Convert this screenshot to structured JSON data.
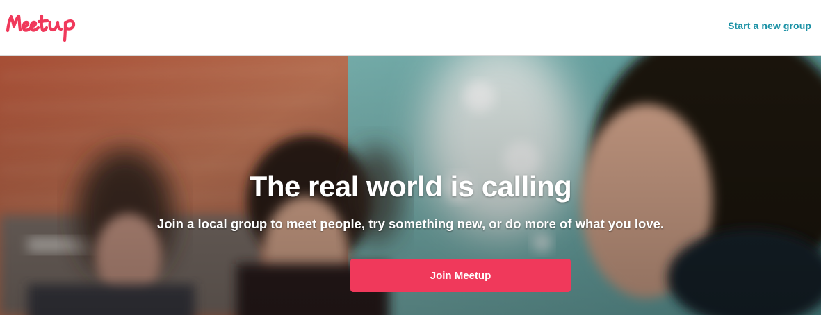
{
  "header": {
    "logo_text": "Meetup",
    "start_group_link": "Start a new group"
  },
  "hero": {
    "headline": "The real world is calling",
    "subheadline": "Join a local group to meet people, try something new, or do more of what you love.",
    "join_button": "Join Meetup"
  },
  "colors": {
    "brand": "#f0395b",
    "link": "#1b91a5",
    "hero_text": "#ffffff"
  }
}
